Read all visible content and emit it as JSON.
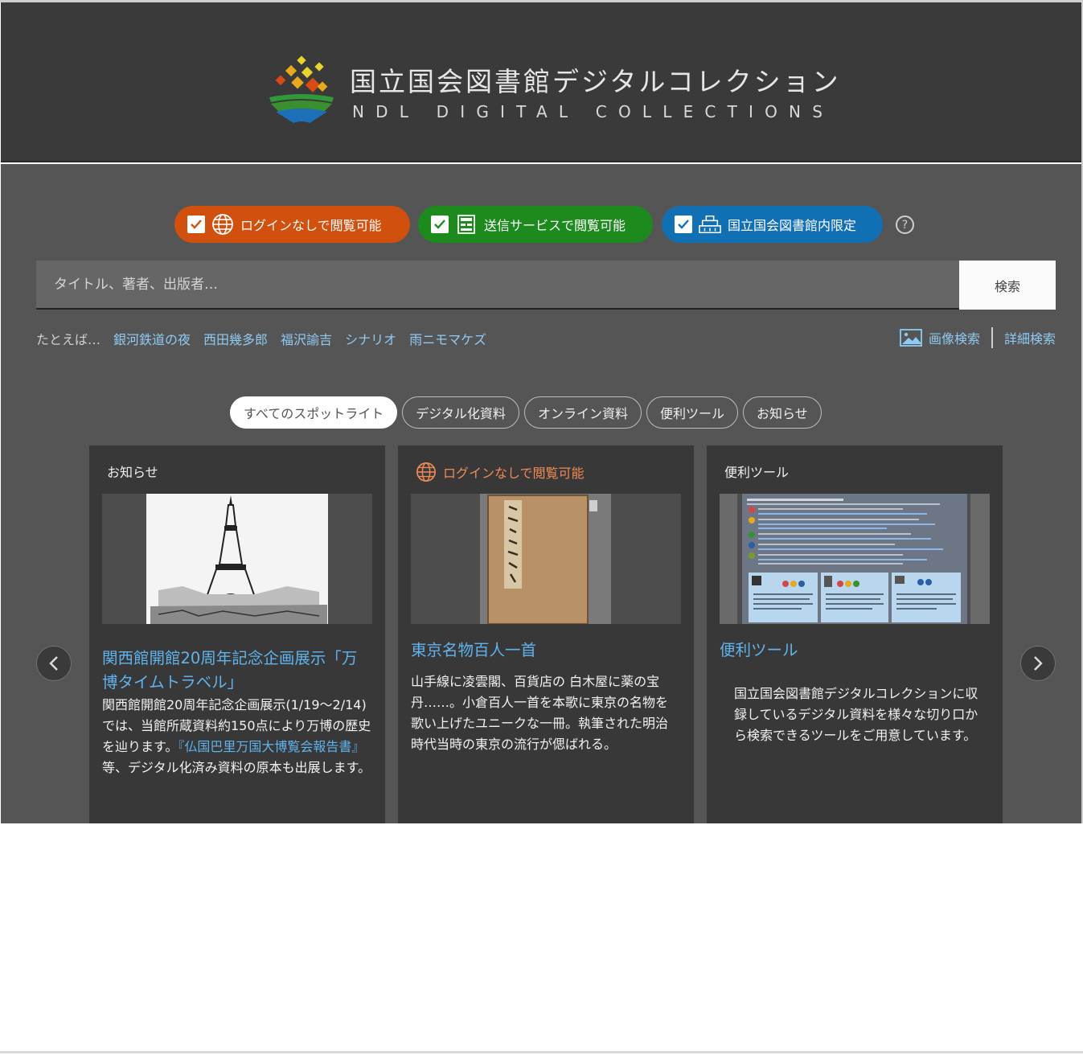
{
  "header": {
    "title_jp": "国立国会図書館デジタルコレクション",
    "title_en": "NDL DIGITAL COLLECTIONS"
  },
  "filters": [
    {
      "label": "ログインなしで閲覧可能",
      "color": "#d1500d",
      "icon": "globe-icon",
      "checked": true
    },
    {
      "label": "送信サービスで閲覧可能",
      "color": "#1c8a1c",
      "icon": "building-icon",
      "checked": true
    },
    {
      "label": "国立国会図書館内限定",
      "color": "#116fb3",
      "icon": "library-icon",
      "checked": true
    }
  ],
  "help": "?",
  "search": {
    "placeholder": "タイトル、著者、出版者…",
    "button_label": "検索"
  },
  "examples": {
    "lead": "たとえば…",
    "items": [
      "銀河鉄道の夜",
      "西田幾多郎",
      "福沢諭吉",
      "シナリオ",
      "雨ニモマケズ"
    ]
  },
  "advanced": {
    "image_search": "画像検索",
    "detail_search": "詳細検索"
  },
  "tabs": [
    {
      "label": "すべてのスポットライト",
      "active": true
    },
    {
      "label": "デジタル化資料",
      "active": false
    },
    {
      "label": "オンライン資料",
      "active": false
    },
    {
      "label": "便利ツール",
      "active": false
    },
    {
      "label": "お知らせ",
      "active": false
    }
  ],
  "cards": [
    {
      "category": "お知らせ",
      "title": "関西館開館20周年記念企画展示「万博タイムトラベル」",
      "desc_line1": "関西館開館20周年記念企画展示(1/19〜2/14)では、当館所蔵資料約150点により万博の歴史を辿ります。",
      "desc_link": "『仏国巴里万国大博覧会報告書』",
      "desc_line2": "等、デジタル化済み資料の原本も出展します。"
    },
    {
      "category": "ログインなしで閲覧可能",
      "title": "東京名物百人一首",
      "desc": "山手線に凌雲閣、百貨店の 白木屋に薬の宝丹……。小倉百人一首を本歌に東京の名物を歌い上げたユニークな一冊。執筆された明治時代当時の東京の流行が偲ばれる。"
    },
    {
      "category": "便利ツール",
      "title": "便利ツール",
      "desc": "国立国会図書館デジタルコレクションに収録しているデジタル資料を様々な切り口から検索できるツールをご用意しています。"
    }
  ],
  "colors": {
    "header_bg": "#3a3a3a",
    "main_bg": "#555555",
    "card_bg": "#383838",
    "link": "#5fb4ee"
  }
}
